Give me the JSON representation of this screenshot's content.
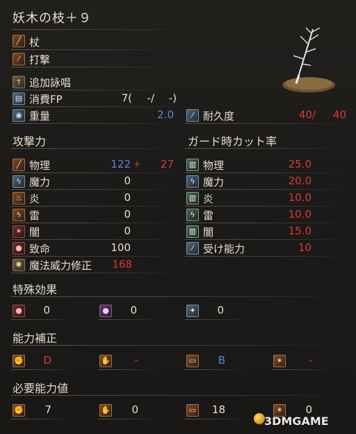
{
  "weapon": {
    "name": "妖木の枝＋９",
    "type": "杖",
    "attack_type": "打撃",
    "skill": "追加詠唱"
  },
  "stats": {
    "fp_label": "消費FP",
    "fp_value": "7(",
    "fp_mid": "-/",
    "fp_end": "-)",
    "weight_label": "重量",
    "weight_value": "2.0",
    "durability_label": "耐久度",
    "durability_current": "40/",
    "durability_max": "40"
  },
  "attack": {
    "title": "攻撃力",
    "rows": [
      {
        "label": "物理",
        "value": "122",
        "bonus": "+",
        "extra": "27"
      },
      {
        "label": "魔力",
        "value": "0"
      },
      {
        "label": "炎",
        "value": "0"
      },
      {
        "label": "雷",
        "value": "0"
      },
      {
        "label": "闇",
        "value": "0"
      },
      {
        "label": "致命",
        "value": "100"
      },
      {
        "label": "魔法威力修正",
        "value": "168"
      }
    ]
  },
  "guard": {
    "title": "ガード時カット率",
    "rows": [
      {
        "label": "物理",
        "value": "25.0"
      },
      {
        "label": "魔力",
        "value": "20.0"
      },
      {
        "label": "炎",
        "value": "10.0"
      },
      {
        "label": "雷",
        "value": "10.0"
      },
      {
        "label": "闇",
        "value": "15.0"
      },
      {
        "label": "受け能力",
        "value": "10"
      }
    ]
  },
  "effects": {
    "title": "特殊効果",
    "items": [
      {
        "icon": "blood-drop-icon",
        "value": "0"
      },
      {
        "icon": "poison-icon",
        "value": "0"
      },
      {
        "icon": "frost-icon",
        "value": "0"
      }
    ]
  },
  "scaling": {
    "title": "能力補正",
    "items": [
      {
        "icon": "strength-icon",
        "value": "D"
      },
      {
        "icon": "dexterity-icon",
        "value": "-"
      },
      {
        "icon": "intelligence-icon",
        "value": "B"
      },
      {
        "icon": "faith-icon",
        "value": "-"
      }
    ]
  },
  "requirements": {
    "title": "必要能力値",
    "items": [
      {
        "icon": "strength-icon",
        "value": "7"
      },
      {
        "icon": "dexterity-icon",
        "value": "0"
      },
      {
        "icon": "intelligence-icon",
        "value": "18"
      },
      {
        "icon": "faith-icon",
        "value": "0"
      }
    ]
  },
  "watermark": {
    "text": "3DMGAME"
  },
  "colors": {
    "blue": "#5d86d8",
    "red": "#d33b36",
    "text": "#e6e0d2"
  }
}
